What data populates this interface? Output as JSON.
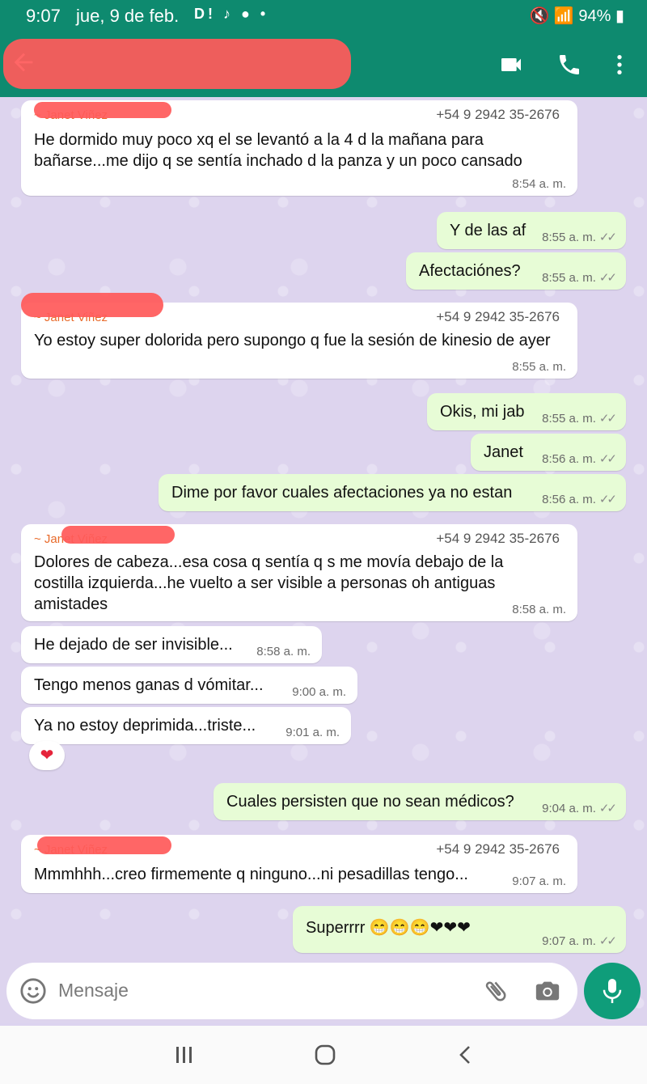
{
  "status_bar": {
    "time": "9:07",
    "date": "jue, 9 de feb.",
    "apps": "D!",
    "battery": "94%"
  },
  "header": {
    "contact_name": "",
    "icons": [
      "back-arrow-icon",
      "video-call-icon",
      "phone-icon",
      "more-vert-icon"
    ]
  },
  "messages": [
    {
      "dir": "in",
      "sender": "~ Janet Viñez",
      "phone": "+54 9 2942 35-2676",
      "text": "He dormido muy poco xq el se levantó a la 4 d la mañana para bañarse...me dijo q se sentía inchado d la panza y un poco cansado",
      "time": "8:54 a. m."
    },
    {
      "dir": "out",
      "text": "Y de las af",
      "time": "8:55 a. m."
    },
    {
      "dir": "out",
      "text": "Afectaciónes?",
      "time": "8:55 a. m."
    },
    {
      "dir": "in",
      "sender": "~ Janet Viñez",
      "phone": "+54 9 2942 35-2676",
      "text": "Yo estoy super dolorida pero supongo q fue la sesión de kinesio de ayer",
      "time": "8:55 a. m."
    },
    {
      "dir": "out",
      "text": "Okis, mi jab",
      "time": "8:55 a. m."
    },
    {
      "dir": "out",
      "text": "Janet",
      "time": "8:56 a. m."
    },
    {
      "dir": "out",
      "text": "Dime por favor cuales afectaciones ya no estan",
      "time": "8:56 a. m."
    },
    {
      "dir": "in",
      "sender": "~ Janet Viñez",
      "phone": "+54 9 2942 35-2676",
      "text": "Dolores de cabeza...esa cosa q sentía q s me movía debajo de la costilla izquierda...he vuelto a ser visible a personas oh antiguas amistades",
      "time": "8:58 a. m."
    },
    {
      "dir": "in",
      "text": "He dejado de ser invisible...",
      "time": "8:58 a. m."
    },
    {
      "dir": "in",
      "text": "Tengo menos ganas d vómitar...",
      "time": "9:00 a. m."
    },
    {
      "dir": "in",
      "text": "Ya no estoy deprimida...triste...",
      "time": "9:01 a. m.",
      "reaction": "❤"
    },
    {
      "dir": "out",
      "text": "Cuales persisten que no sean médicos?",
      "time": "9:04 a. m."
    },
    {
      "dir": "in",
      "sender": "~ Janet Viñez",
      "phone": "+54 9 2942 35-2676",
      "text": "Mmmhhh...creo firmemente q ninguno...ni pesadillas tengo...",
      "time": "9:07 a. m."
    },
    {
      "dir": "out",
      "text": "Superrrr 😁😁😁❤❤❤",
      "time": "9:07 a. m."
    }
  ],
  "input": {
    "placeholder": "Mensaje"
  },
  "colors": {
    "header": "#0e8a6f",
    "incoming": "#ffffff",
    "outgoing": "#e7fcd6",
    "sender": "#e86a2a",
    "mic": "#0f9d7a"
  }
}
